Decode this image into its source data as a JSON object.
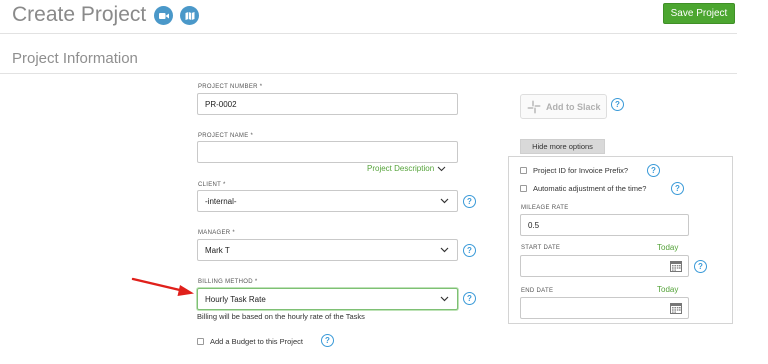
{
  "header": {
    "title": "Create Project",
    "save_label": "Save Project",
    "video_icon": "video-camera-icon",
    "map_icon": "map-icon"
  },
  "section": {
    "title": "Project Information"
  },
  "form": {
    "project_number": {
      "label": "PROJECT NUMBER *",
      "value": "PR-0002"
    },
    "project_name": {
      "label": "PROJECT NAME *",
      "value": "",
      "description_link": "Project Description"
    },
    "client": {
      "label": "CLIENT *",
      "value": "-internal-"
    },
    "manager": {
      "label": "MANAGER *",
      "value": "Mark T"
    },
    "billing_method": {
      "label": "BILLING METHOD *",
      "value": "Hourly Task Rate",
      "hint": "Billing will be based on the hourly rate of the Tasks"
    },
    "budget": {
      "label": "Add a Budget to this Project",
      "checked": false
    }
  },
  "side": {
    "slack_label": "Add to Slack",
    "toggle_label": "Hide more options",
    "options": {
      "prefix_label": "Project ID for Invoice Prefix?",
      "auto_adjust_label": "Automatic adjustment of the time?",
      "mileage_label": "MILEAGE RATE",
      "mileage_value": "0.5",
      "start_label": "START DATE",
      "end_label": "END DATE",
      "today_label": "Today"
    }
  },
  "help_glyph": "?",
  "colors": {
    "accent_blue": "#4a98c9",
    "save_green": "#4ca630",
    "link_green": "#55a33a",
    "annotation_red": "#e0201b"
  }
}
